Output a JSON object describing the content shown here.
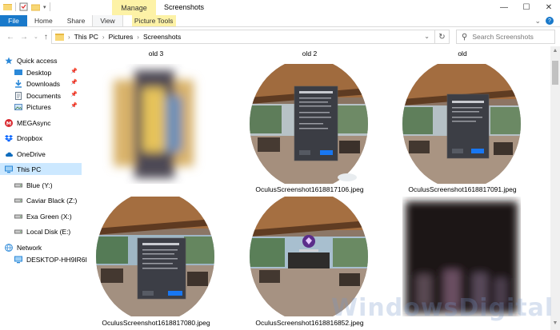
{
  "window": {
    "title": "Screenshots",
    "context_tab": "Manage",
    "controls": [
      "—",
      "☐",
      "✕"
    ]
  },
  "ribbon": {
    "tabs": [
      "File",
      "Home",
      "Share",
      "View",
      "Picture Tools"
    ]
  },
  "address": {
    "crumbs": [
      "This PC",
      "Pictures",
      "Screenshots"
    ]
  },
  "search": {
    "placeholder": "Search Screenshots"
  },
  "nav": {
    "quick_access": "Quick access",
    "items": [
      "Desktop",
      "Downloads",
      "Documents",
      "Pictures"
    ],
    "mega": "MEGAsync",
    "dropbox": "Dropbox",
    "onedrive": "OneDrive",
    "thispc": "This PC",
    "drives": [
      "Blue (Y:)",
      "Caviar Black (Z:)",
      "Exa Green (X:)",
      "Local Disk (E:)"
    ],
    "network": "Network",
    "desktop_pc": "DESKTOP-HH9IR6I"
  },
  "content": {
    "folders": [
      "old 3",
      "old 2",
      "old"
    ],
    "files": [
      "OculusScreenshot1618817106.jpeg",
      "OculusScreenshot1618817091.jpeg",
      "OculusScreenshot1618817080.jpeg",
      "OculusScreenshot1618816852.jpeg"
    ]
  },
  "watermark": "WindowsDigital"
}
